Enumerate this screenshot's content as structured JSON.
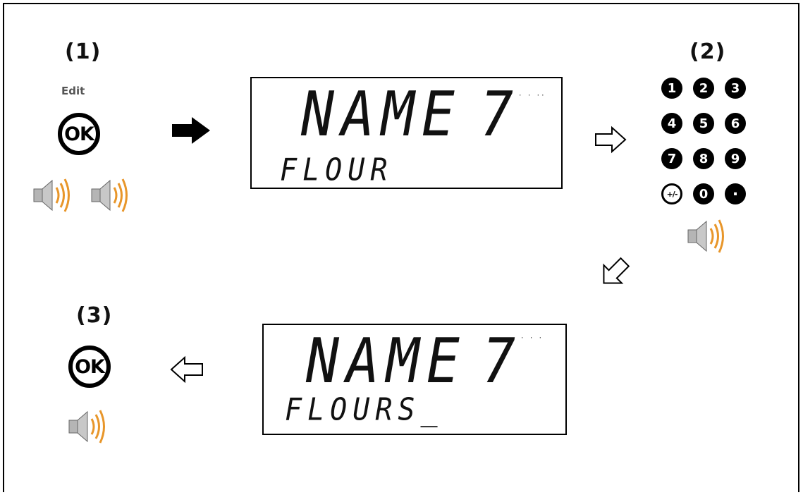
{
  "steps": {
    "one": "(1)",
    "two": "(2)",
    "three": "(3)"
  },
  "edit_label": "Edit",
  "ok_label": "OK",
  "display_1": {
    "main": "NAME",
    "number": "7",
    "sub": "FLOUR"
  },
  "display_2": {
    "main": "NAME",
    "number": "7",
    "sub": "FLOURS_"
  },
  "keypad": {
    "keys": [
      "1",
      "2",
      "3",
      "4",
      "5",
      "6",
      "7",
      "8",
      "9",
      "+/-",
      "0",
      "."
    ]
  },
  "icons": [
    "ok-icon",
    "speaker-icon",
    "arrow-right-filled-icon",
    "arrow-right-outline-icon",
    "arrow-down-left-outline-icon",
    "arrow-left-outline-icon"
  ],
  "colors": {
    "sound_waves": "#e8962a",
    "speaker_body": "#b0b0b0"
  }
}
